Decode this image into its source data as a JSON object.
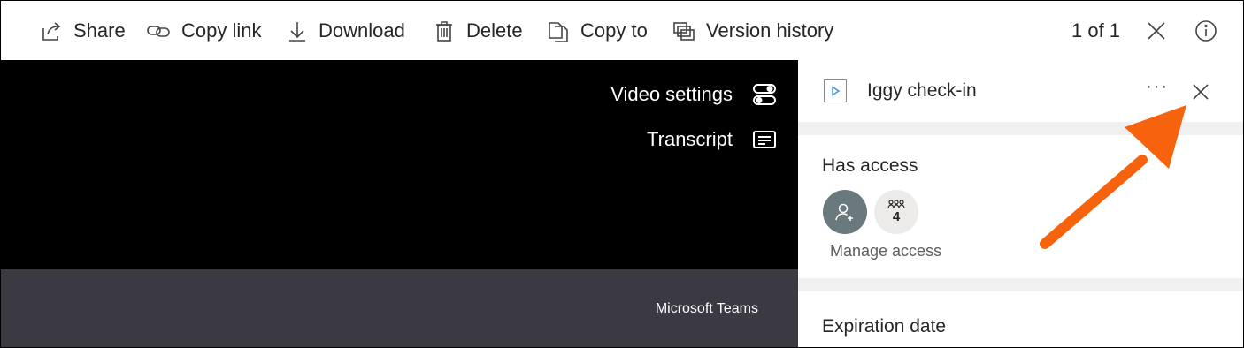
{
  "toolbar": {
    "share_label": "Share",
    "copy_link_label": "Copy link",
    "download_label": "Download",
    "delete_label": "Delete",
    "copy_to_label": "Copy to",
    "version_history_label": "Version history",
    "page_counter": "1 of 1"
  },
  "video": {
    "video_settings_label": "Video settings",
    "transcript_label": "Transcript",
    "brand_label": "Microsoft Teams"
  },
  "panel": {
    "file_title": "Iggy check-in",
    "more_label": "···",
    "has_access_title": "Has access",
    "group_count": "4",
    "manage_access_label": "Manage access",
    "expiration_title": "Expiration date"
  },
  "colors": {
    "toolbar_bg": "#ffffff",
    "video_bg": "#000000",
    "video_bottom_bg": "#3b3a43",
    "panel_separator": "#f0f0f0",
    "avatar_person": "#69797e",
    "avatar_group": "#edebe9",
    "annotation_arrow": "#f7630c"
  },
  "icons": {
    "share": "share-icon",
    "copy_link": "link-icon",
    "download": "download-icon",
    "delete": "trash-icon",
    "copy_to": "copy-icon",
    "version_history": "version-history-icon",
    "close": "close-icon",
    "info": "info-icon",
    "video_settings": "toggle-settings-icon",
    "transcript": "transcript-icon",
    "file": "video-file-icon",
    "add_person": "add-person-icon",
    "group": "group-icon"
  }
}
